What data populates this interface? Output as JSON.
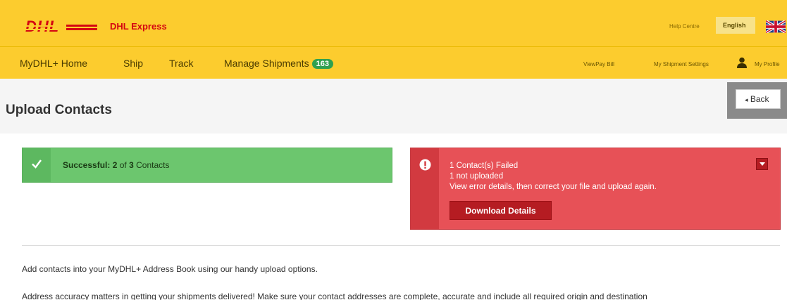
{
  "header": {
    "logo_text": "DHL",
    "brand": "DHL Express",
    "help_centre": "Help Centre",
    "language": "English",
    "brand_color": "#d40511",
    "bar_color": "#fccc2e"
  },
  "nav": {
    "items": [
      {
        "label": "MyDHL+ Home"
      },
      {
        "label": "Ship"
      },
      {
        "label": "Track"
      },
      {
        "label": "Manage Shipments",
        "badge": "163"
      }
    ],
    "right": {
      "paybill": "ViewPay Bill",
      "settings": "My Shipment Settings",
      "profile": "My Profile"
    }
  },
  "page": {
    "title": "Upload Contacts",
    "back_label": "Back"
  },
  "success": {
    "prefix": "Successful: ",
    "count": "2",
    "middle": " of ",
    "total": "3",
    "suffix": " Contacts",
    "color": "#6cc66e"
  },
  "error": {
    "line1": "1 Contact(s) Failed",
    "line2": "1 not uploaded",
    "line3": "View error details, then correct your file and upload again.",
    "button": "Download Details",
    "color": "#e75157"
  },
  "info": {
    "line1": "Add contacts into your MyDHL+ Address Book using our handy upload options.",
    "line2": "Address accuracy matters in getting your shipments delivered! Make sure your contact addresses are complete, accurate and include all required origin and destination"
  }
}
